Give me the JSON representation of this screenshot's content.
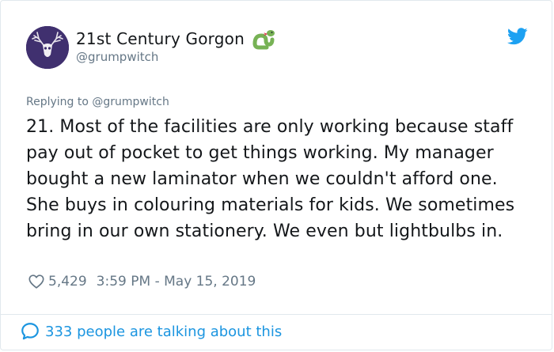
{
  "author": {
    "display_name": "21st Century Gorgon",
    "handle": "@grumpwitch",
    "avatar_icon": "stag-skull-avatar",
    "badge_icon": "snake-emoji-icon"
  },
  "platform_icon": "twitter-bird-icon",
  "reply": {
    "text": "Replying to @grumpwitch"
  },
  "tweet": {
    "text": "21. Most of the facilities are only working because staff pay out of pocket to get things working. My manager bought a new laminator when we couldn't afford one. She buys in colouring materials for kids. We sometimes bring in our own stationery. We even but lightbulbs in."
  },
  "meta": {
    "like_icon": "heart-icon",
    "likes": "5,429",
    "timestamp": "3:59 PM - May 15, 2019"
  },
  "conversation": {
    "icon": "speech-bubble-icon",
    "text": "333 people are talking about this"
  },
  "colors": {
    "link_blue": "#1b95e0",
    "twitter_blue": "#1da1f2",
    "muted_gray": "#657786",
    "text_dark": "#14171a",
    "border": "#e1e8ed"
  }
}
